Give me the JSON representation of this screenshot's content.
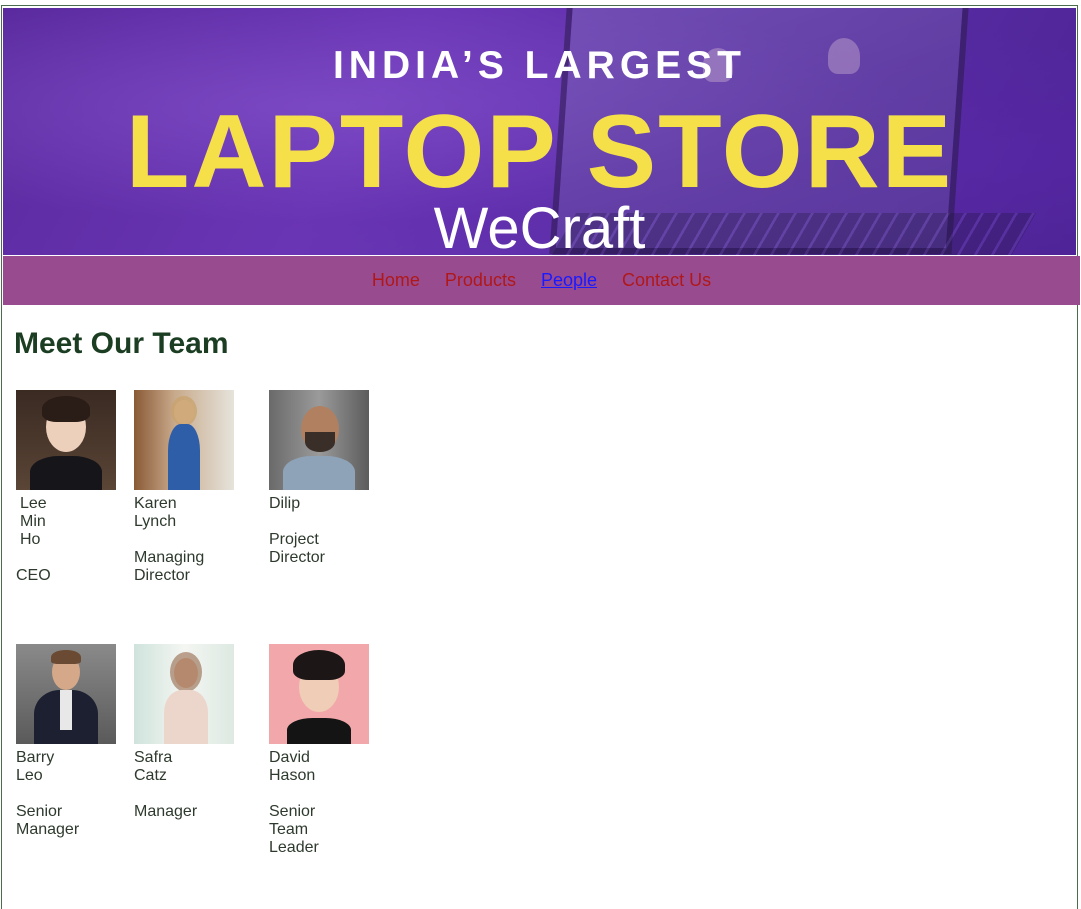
{
  "banner": {
    "line1": "INDIA’S LARGEST",
    "line2": "LAPTOP STORE",
    "brand": "WeCraft"
  },
  "nav": {
    "items": [
      {
        "label": "Home"
      },
      {
        "label": "Products"
      },
      {
        "label": "People"
      },
      {
        "label": "Contact Us"
      }
    ],
    "active": "People"
  },
  "page": {
    "title": "Meet Our Team"
  },
  "team": [
    {
      "name": "Lee\nMin\n Ho",
      "role": "CEO"
    },
    {
      "name": "Karen\nLynch",
      "role": "Managing\nDirector"
    },
    {
      "name": " Dilip",
      "role": "Project\nDirector"
    },
    {
      "name": "Barry\n Leo",
      "role": "Senior\nManager"
    },
    {
      "name": "Safra\n Catz",
      "role": "Manager"
    },
    {
      "name": "David\nHason",
      "role": "Senior\n Team\nLeader"
    }
  ],
  "colors": {
    "nav_bg": "#994b90",
    "nav_link": "#b01818",
    "nav_active": "#1a1aff",
    "heading": "#1b3d22",
    "banner_yellow": "#f5e04a"
  }
}
